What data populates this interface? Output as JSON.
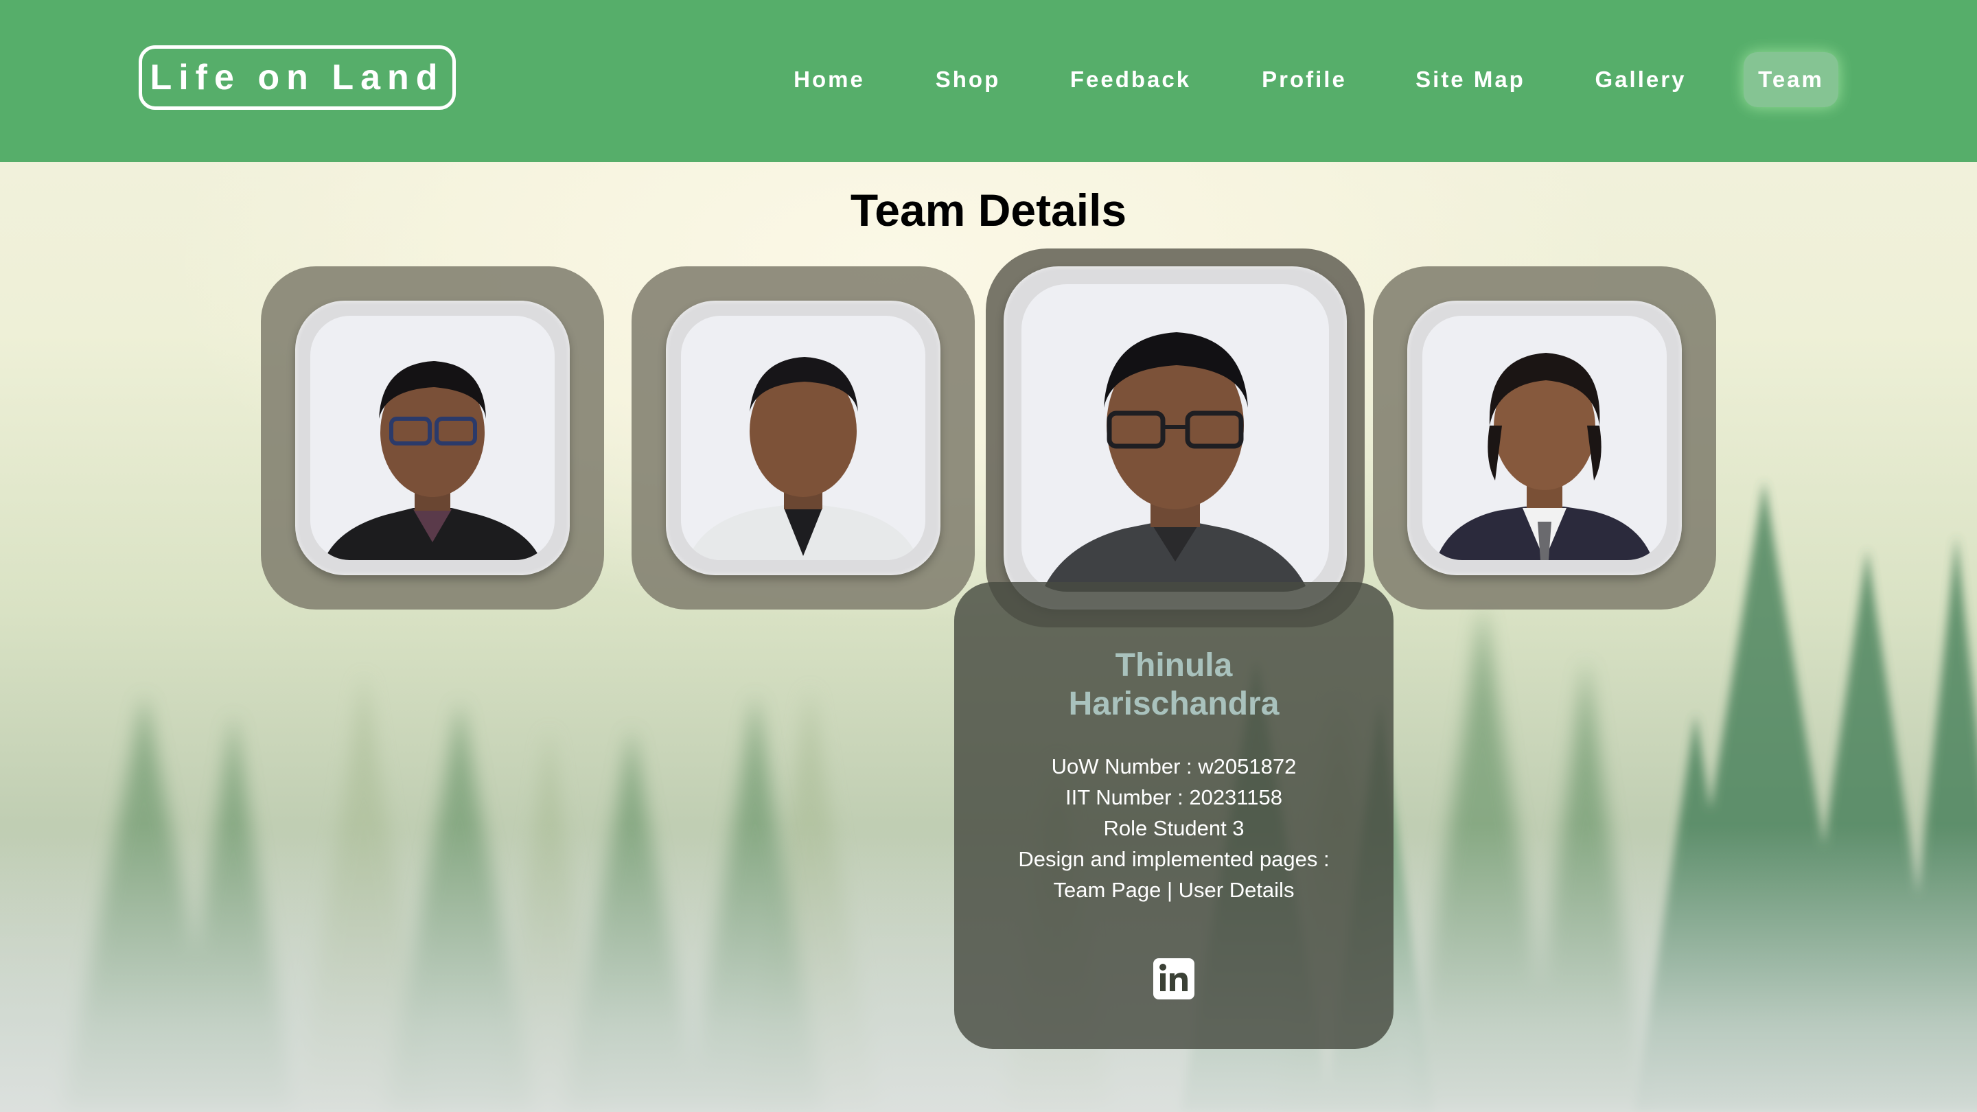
{
  "header": {
    "logo": "Life on Land",
    "nav": [
      {
        "label": "Home",
        "active": false
      },
      {
        "label": "Shop",
        "active": false
      },
      {
        "label": "Feedback",
        "active": false
      },
      {
        "label": "Profile",
        "active": false
      },
      {
        "label": "Site Map",
        "active": false
      },
      {
        "label": "Gallery",
        "active": false
      },
      {
        "label": "Team",
        "active": true
      }
    ]
  },
  "page": {
    "title": "Team Details"
  },
  "members": [
    {
      "photo": "team-member-photo"
    },
    {
      "photo": "team-member-photo"
    },
    {
      "photo": "team-member-photo",
      "hovered": true
    },
    {
      "photo": "team-member-photo"
    }
  ],
  "active_member": {
    "name_line1": "Thinula",
    "name_line2": "Harischandra",
    "uow": "UoW Number : w2051872",
    "iit": "IIT Number : 20231158",
    "role": "Role Student 3",
    "pages_label": "Design and implemented pages :",
    "pages": "Team Page | User Details",
    "social_icon": "linkedin-icon"
  },
  "colors": {
    "header_green": "#56ae6a",
    "card_gray": "#827f70",
    "name_color": "#a9c2bd"
  }
}
